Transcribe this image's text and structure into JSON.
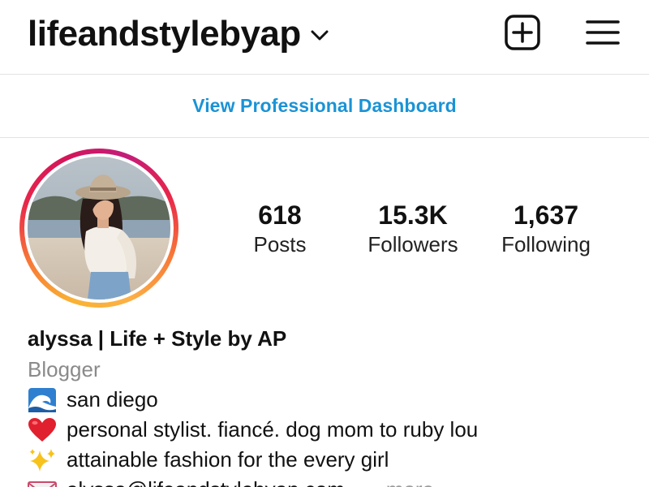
{
  "header": {
    "username": "lifeandstylebyap",
    "dropdown_icon": "chevron-down-icon",
    "new_post_icon": "plus-square-icon",
    "menu_icon": "hamburger-menu-icon"
  },
  "dashboard": {
    "link_label": "View Professional Dashboard",
    "link_color": "#1a93d6"
  },
  "profile": {
    "avatar_icon": "profile-photo",
    "stats": {
      "posts": {
        "value": "618",
        "label": "Posts"
      },
      "followers": {
        "value": "15.3K",
        "label": "Followers"
      },
      "following": {
        "value": "1,637",
        "label": "Following"
      }
    }
  },
  "bio": {
    "display_name": "alyssa | Life + Style by AP",
    "category": "Blogger",
    "lines": [
      {
        "icon": "wave-emoji",
        "text": "san diego"
      },
      {
        "icon": "red-heart-emoji",
        "text": "personal stylist. fiancé. dog mom to ruby lou"
      },
      {
        "icon": "sparkles-emoji",
        "text": "attainable fashion for the every girl"
      },
      {
        "icon": "envelope-emoji",
        "text": "alyssa@lifeandstylebyap.com"
      }
    ],
    "more_label": "... more"
  }
}
